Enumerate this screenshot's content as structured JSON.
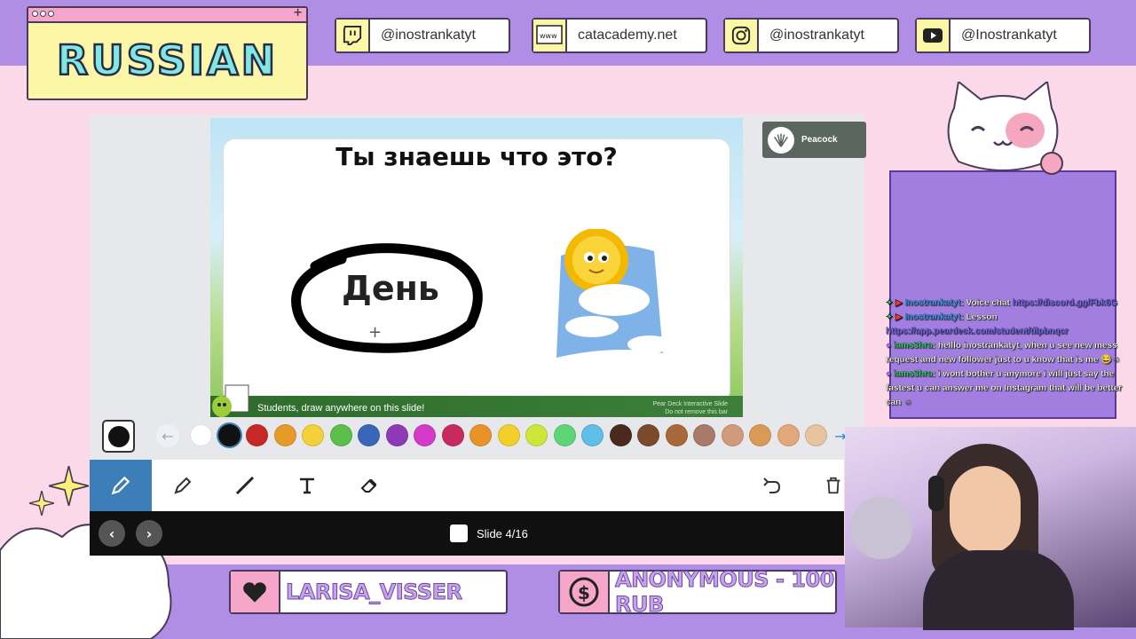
{
  "overlay": {
    "title": "RUSSIAN",
    "socials": [
      {
        "icon": "twitch-icon",
        "label": "@inostrankatyt"
      },
      {
        "icon": "website-icon",
        "label": "catacademy.net"
      },
      {
        "icon": "instagram-icon",
        "label": "@inostrankatyt"
      },
      {
        "icon": "youtube-icon",
        "label": "@Inostrankatyt"
      }
    ],
    "alerts": [
      {
        "icon": "heart-icon",
        "label": "LARISA_VISSER"
      },
      {
        "icon": "dollar-icon",
        "label": "ANONYMOUS - 100 RUB"
      }
    ]
  },
  "slide": {
    "question": "Ты знаешь что это?",
    "answer_word": "День",
    "peardeck_prompt": "Students, draw anywhere on this slide!",
    "peardeck_note": [
      "Pear Deck Interactive Slide",
      "Do not remove this bar"
    ],
    "brand_label": "Peacock"
  },
  "palette": {
    "current_color": "#111111",
    "colors": [
      "#ffffff",
      "#111111",
      "#c62828",
      "#e59a2a",
      "#f3d13a",
      "#5cbf4a",
      "#3a66b8",
      "#8e3ab8",
      "#d43ac8",
      "#c92a5e",
      "#e8922a",
      "#f2cf2a",
      "#cde63a",
      "#5ed678",
      "#5fbfe6",
      "#4a2a1c",
      "#7a4a2c",
      "#a8693a",
      "#a77a6a",
      "#d19a7a",
      "#d99a58",
      "#e2a87a",
      "#e8c3a0"
    ]
  },
  "navigation": {
    "slide_label": "Slide 4/16"
  },
  "chat": [
    {
      "user": "Inostrankatyt",
      "text": ": Voice chat ",
      "link": "https://discord.gg/Fbk6G"
    },
    {
      "user": "Inostrankatyt",
      "text": ": Lesson",
      "link": ""
    },
    {
      "user": "",
      "text": "",
      "link": "https://app.peardeck.com/student/tilpbnqcr"
    },
    {
      "user2": "iams3hra",
      "text": ": helllo inostrankatyt, when u see new mess"
    },
    {
      "user2": "",
      "text": "request and new follower just to u know that is me 😂☺"
    },
    {
      "user2": "iams3hra",
      "text": ": i wont bother u anymore i will just say the"
    },
    {
      "user2": "",
      "text": "fastest u can answer me on Instagram that will be better"
    },
    {
      "user2": "",
      "text": "can ☺"
    }
  ]
}
